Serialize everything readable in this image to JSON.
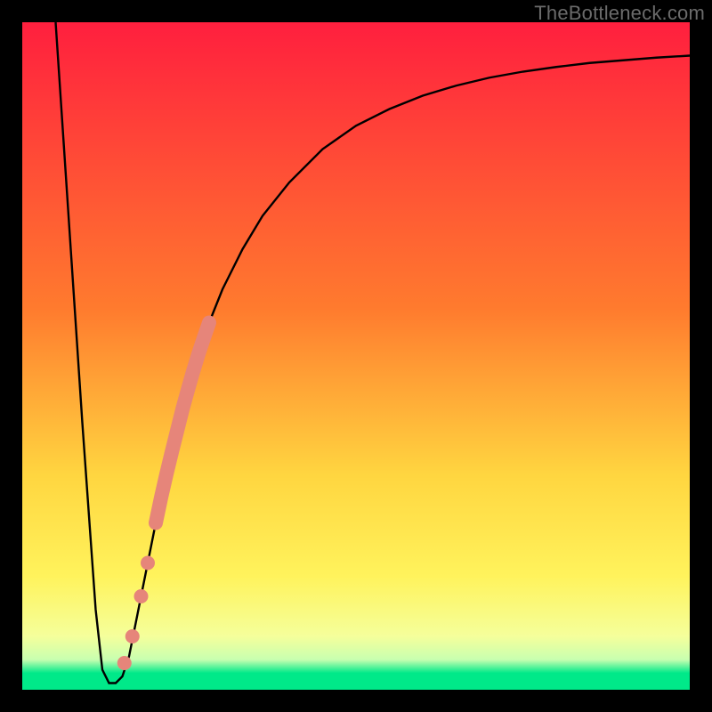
{
  "watermark": "TheBottleneck.com",
  "colors": {
    "frame": "#000000",
    "curve": "#000000",
    "marker": "#E6857A",
    "grad_top": "#FF1F3E",
    "grad_mid_hi": "#FF7B2E",
    "grad_mid": "#FFD640",
    "grad_mid_lo": "#FFF35C",
    "grad_pale": "#F5FF9B",
    "grad_green": "#00E989"
  },
  "chart_data": {
    "type": "line",
    "title": "",
    "xlabel": "",
    "ylabel": "",
    "xlim": [
      0,
      100
    ],
    "ylim": [
      0,
      100
    ],
    "curve": {
      "name": "bottleneck-curve",
      "x": [
        5,
        7,
        9,
        11,
        12,
        13,
        14,
        15,
        16,
        17,
        18,
        20,
        22,
        24,
        26,
        28,
        30,
        33,
        36,
        40,
        45,
        50,
        55,
        60,
        65,
        70,
        75,
        80,
        85,
        90,
        95,
        100
      ],
      "y": [
        100,
        70,
        40,
        12,
        3,
        1,
        1,
        2,
        5,
        10,
        15,
        25,
        34,
        42,
        49,
        55,
        60,
        66,
        71,
        76,
        81,
        84.5,
        87,
        89,
        90.5,
        91.7,
        92.6,
        93.3,
        93.9,
        94.3,
        94.7,
        95
      ]
    },
    "marker_band": {
      "name": "highlighted-range",
      "x": [
        20.0,
        20.8,
        21.6,
        22.4,
        23.2,
        24.0,
        24.8,
        25.6,
        26.4,
        27.2,
        28.0
      ],
      "y": [
        25.0,
        28.8,
        32.3,
        35.6,
        38.8,
        42.0,
        44.9,
        47.7,
        50.3,
        52.7,
        55.0
      ]
    },
    "marker_dots": {
      "name": "isolated-points",
      "points": [
        {
          "x": 15.3,
          "y": 4.0
        },
        {
          "x": 16.5,
          "y": 8.0
        },
        {
          "x": 17.8,
          "y": 14.0
        },
        {
          "x": 18.8,
          "y": 19.0
        }
      ]
    }
  }
}
